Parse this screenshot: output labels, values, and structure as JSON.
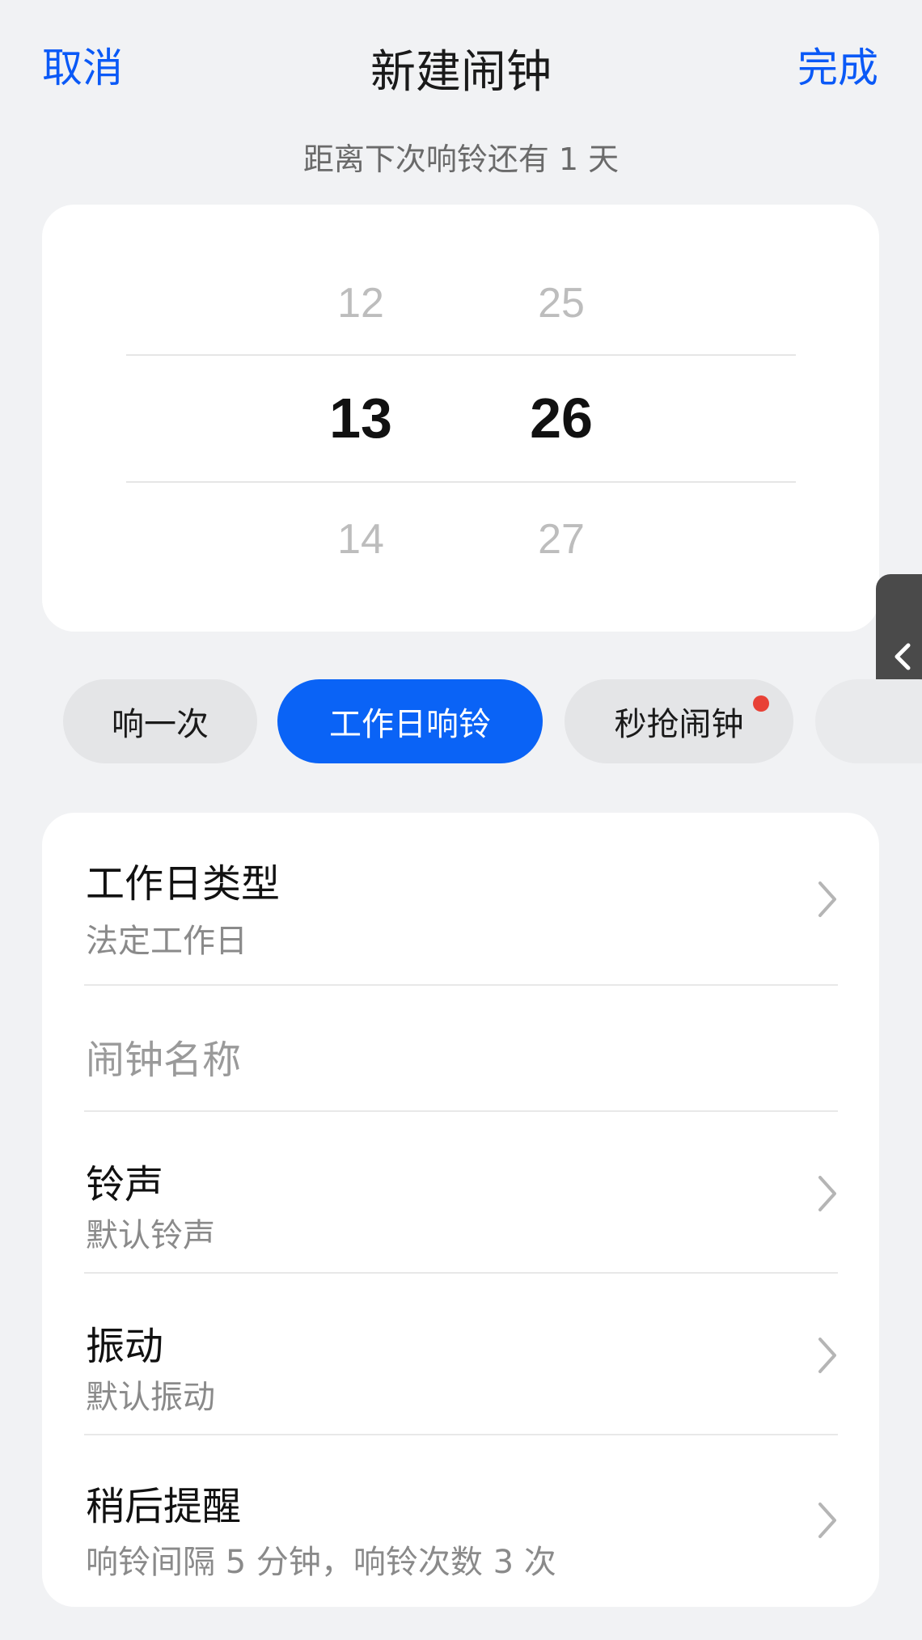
{
  "header": {
    "cancel_label": "取消",
    "title": "新建闹钟",
    "done_label": "完成",
    "subtitle": "距离下次响铃还有 1 天"
  },
  "picker": {
    "hours": {
      "prev": "12",
      "current": "13",
      "next": "14"
    },
    "minutes": {
      "prev": "25",
      "current": "26",
      "next": "27"
    }
  },
  "modes": [
    {
      "label": "响一次",
      "active": false
    },
    {
      "label": "工作日响铃",
      "active": true
    },
    {
      "label": "秒抢闹钟",
      "active": false,
      "badge": "red-dot"
    },
    {
      "label": "",
      "active": false
    }
  ],
  "settings": {
    "workday_type": {
      "title": "工作日类型",
      "value": "法定工作日"
    },
    "alarm_name": {
      "placeholder": "闹钟名称"
    },
    "ringtone": {
      "title": "铃声",
      "value": "默认铃声"
    },
    "vibration": {
      "title": "振动",
      "value": "默认振动"
    },
    "snooze": {
      "title": "稍后提醒",
      "value": "响铃间隔 5 分钟，响铃次数 3 次"
    }
  },
  "colors": {
    "accent": "#0a59f7",
    "chip_active": "#0a63f6",
    "badge": "#e84136",
    "background": "#f1f2f4"
  },
  "icons": {
    "chevron": "chevron-right-icon",
    "side_handle": "chevron-left-icon"
  }
}
